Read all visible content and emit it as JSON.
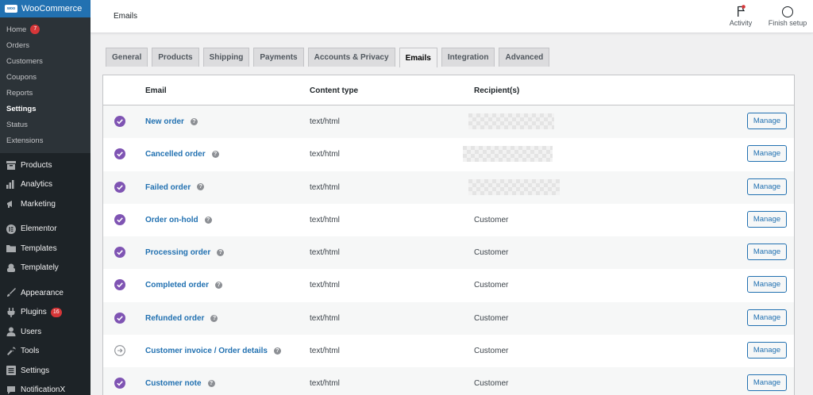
{
  "sidebar": {
    "brand": "WooCommerce",
    "submenu": [
      {
        "label": "Home",
        "badge": "7"
      },
      {
        "label": "Orders"
      },
      {
        "label": "Customers"
      },
      {
        "label": "Coupons"
      },
      {
        "label": "Reports"
      },
      {
        "label": "Settings",
        "active": true
      },
      {
        "label": "Status"
      },
      {
        "label": "Extensions"
      }
    ],
    "menu": [
      {
        "label": "Products",
        "icon": "archive-icon"
      },
      {
        "label": "Analytics",
        "icon": "bar-chart-icon"
      },
      {
        "label": "Marketing",
        "icon": "megaphone-icon"
      },
      {
        "label": "Elementor",
        "icon": "elementor-icon"
      },
      {
        "label": "Templates",
        "icon": "folder-icon"
      },
      {
        "label": "Templately",
        "icon": "templately-icon"
      },
      {
        "label": "Appearance",
        "icon": "brush-icon"
      },
      {
        "label": "Plugins",
        "icon": "plug-icon",
        "badge": "16"
      },
      {
        "label": "Users",
        "icon": "user-icon"
      },
      {
        "label": "Tools",
        "icon": "wrench-icon"
      },
      {
        "label": "Settings",
        "icon": "settings-icon"
      },
      {
        "label": "NotificationX",
        "icon": "notificationx-icon"
      }
    ]
  },
  "header": {
    "title": "Emails",
    "activity_label": "Activity",
    "finish_label": "Finish setup"
  },
  "tabs": [
    "General",
    "Products",
    "Shipping",
    "Payments",
    "Accounts & Privacy",
    "Emails",
    "Integration",
    "Advanced"
  ],
  "active_tab": "Emails",
  "table": {
    "columns": {
      "email": "Email",
      "content_type": "Content type",
      "recipients": "Recipient(s)"
    },
    "manage_label": "Manage",
    "rows": [
      {
        "name": "New order",
        "content_type": "text/html",
        "recipient": "",
        "status": "enabled"
      },
      {
        "name": "Cancelled order",
        "content_type": "text/html",
        "recipient": "",
        "status": "enabled"
      },
      {
        "name": "Failed order",
        "content_type": "text/html",
        "recipient": "",
        "status": "enabled"
      },
      {
        "name": "Order on-hold",
        "content_type": "text/html",
        "recipient": "Customer",
        "status": "enabled"
      },
      {
        "name": "Processing order",
        "content_type": "text/html",
        "recipient": "Customer",
        "status": "enabled"
      },
      {
        "name": "Completed order",
        "content_type": "text/html",
        "recipient": "Customer",
        "status": "enabled"
      },
      {
        "name": "Refunded order",
        "content_type": "text/html",
        "recipient": "Customer",
        "status": "enabled"
      },
      {
        "name": "Customer invoice / Order details",
        "content_type": "text/html",
        "recipient": "Customer",
        "status": "manual"
      },
      {
        "name": "Customer note",
        "content_type": "text/html",
        "recipient": "Customer",
        "status": "enabled"
      }
    ]
  },
  "colors": {
    "accent": "#2271b1",
    "enabled": "#7f54b3",
    "sidebar": "#1d2327"
  }
}
